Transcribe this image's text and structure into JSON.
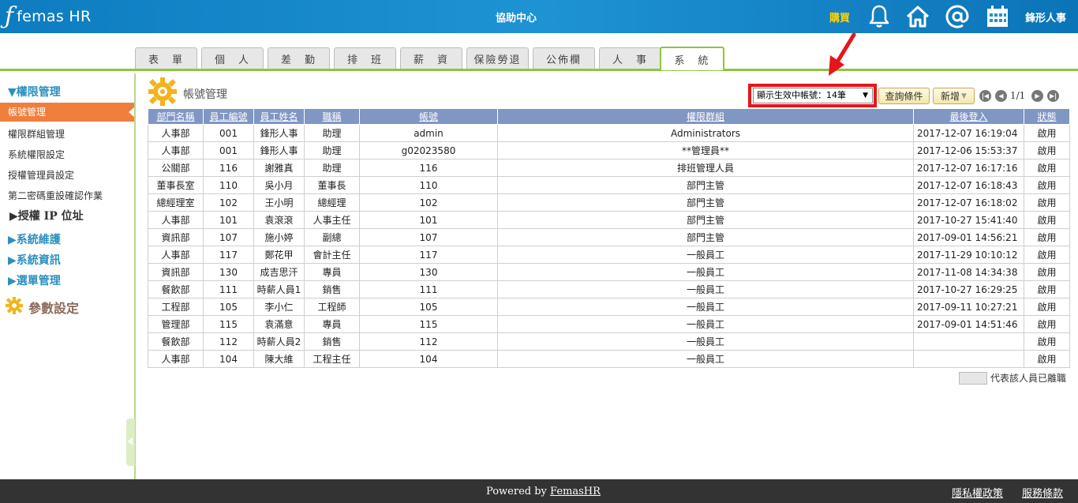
{
  "header": {
    "logo_text": "femas HR",
    "logo_mark": "ƒ",
    "help_center": "協助中心",
    "buy": "購買",
    "company": "鋒形人事",
    "icons": [
      "bell-icon",
      "home-icon",
      "at-icon",
      "calendar-icon"
    ]
  },
  "tabs": [
    {
      "label": "表　單"
    },
    {
      "label": "個　人"
    },
    {
      "label": "差　勤"
    },
    {
      "label": "排　班"
    },
    {
      "label": "薪　資"
    },
    {
      "label": "保險勞退"
    },
    {
      "label": "公佈欄"
    },
    {
      "label": "人　事"
    },
    {
      "label": "系　統",
      "active": true
    }
  ],
  "sidebar": {
    "section_rights": "▼權限管理",
    "items": [
      {
        "label": "帳號管理",
        "active": true
      },
      {
        "label": "權限群組管理"
      },
      {
        "label": "系統權限設定"
      },
      {
        "label": "授權管理員設定"
      },
      {
        "label": "第二密碼重設確認作業"
      }
    ],
    "ip_section": "▶授權 IP 位址",
    "sections": [
      "▶系統維護",
      "▶系統資訊",
      "▶選單管理"
    ],
    "param": "參數設定"
  },
  "main": {
    "title": "帳號管理",
    "filter": {
      "selected": "顯示生效中帳號：14筆"
    },
    "query_button": "查詢條件",
    "add_button": "新增",
    "page_info": "1/1",
    "legend": "代表該人員已離職"
  },
  "table": {
    "headers": [
      "部門名稱",
      "員工編號",
      "員工姓名",
      "職稱",
      "帳號",
      "權限群組",
      "最後登入",
      "狀態"
    ],
    "rows": [
      [
        "人事部",
        "001",
        "鋒形人事",
        "助理",
        "admin",
        "Administrators",
        "2017-12-07 16:19:04",
        "啟用"
      ],
      [
        "人事部",
        "001",
        "鋒形人事",
        "助理",
        "g02023580",
        "**管理員**",
        "2017-12-06 15:53:37",
        "啟用"
      ],
      [
        "公關部",
        "116",
        "謝雅真",
        "助理",
        "116",
        "排班管理人員",
        "2017-12-07 16:17:16",
        "啟用"
      ],
      [
        "董事長室",
        "110",
        "吳小月",
        "董事長",
        "110",
        "部門主管",
        "2017-12-07 16:18:43",
        "啟用"
      ],
      [
        "總經理室",
        "102",
        "王小明",
        "總經理",
        "102",
        "部門主管",
        "2017-12-07 16:18:02",
        "啟用"
      ],
      [
        "人事部",
        "101",
        "袁滾滾",
        "人事主任",
        "101",
        "部門主管",
        "2017-10-27 15:41:40",
        "啟用"
      ],
      [
        "資訊部",
        "107",
        "施小婷",
        "副總",
        "107",
        "部門主管",
        "2017-09-01 14:56:21",
        "啟用"
      ],
      [
        "人事部",
        "117",
        "鄭花甲",
        "會計主任",
        "117",
        "一般員工",
        "2017-11-29 10:10:12",
        "啟用"
      ],
      [
        "資訊部",
        "130",
        "成吉思汗",
        "專員",
        "130",
        "一般員工",
        "2017-11-08 14:34:38",
        "啟用"
      ],
      [
        "餐飲部",
        "111",
        "時薪人員1",
        "銷售",
        "111",
        "一般員工",
        "2017-10-27 16:29:25",
        "啟用"
      ],
      [
        "工程部",
        "105",
        "李小仁",
        "工程師",
        "105",
        "一般員工",
        "2017-09-11 10:27:21",
        "啟用"
      ],
      [
        "管理部",
        "115",
        "袁滿意",
        "專員",
        "115",
        "一般員工",
        "2017-09-01 14:51:46",
        "啟用"
      ],
      [
        "餐飲部",
        "112",
        "時薪人員2",
        "銷售",
        "112",
        "一般員工",
        "",
        "啟用"
      ],
      [
        "人事部",
        "104",
        "陳大維",
        "工程主任",
        "104",
        "一般員工",
        "",
        "啟用"
      ]
    ]
  },
  "footer": {
    "powered_prefix": "Powered by ",
    "powered_link": "FemasHR",
    "privacy": "隱私權政策",
    "terms": "服務條款"
  },
  "colors": {
    "header_blue": "#1e93d3",
    "tab_green": "#8cc63f",
    "sidebar_active": "#f07f3c",
    "table_header": "#8096c3",
    "highlight_red": "#e8141a"
  }
}
